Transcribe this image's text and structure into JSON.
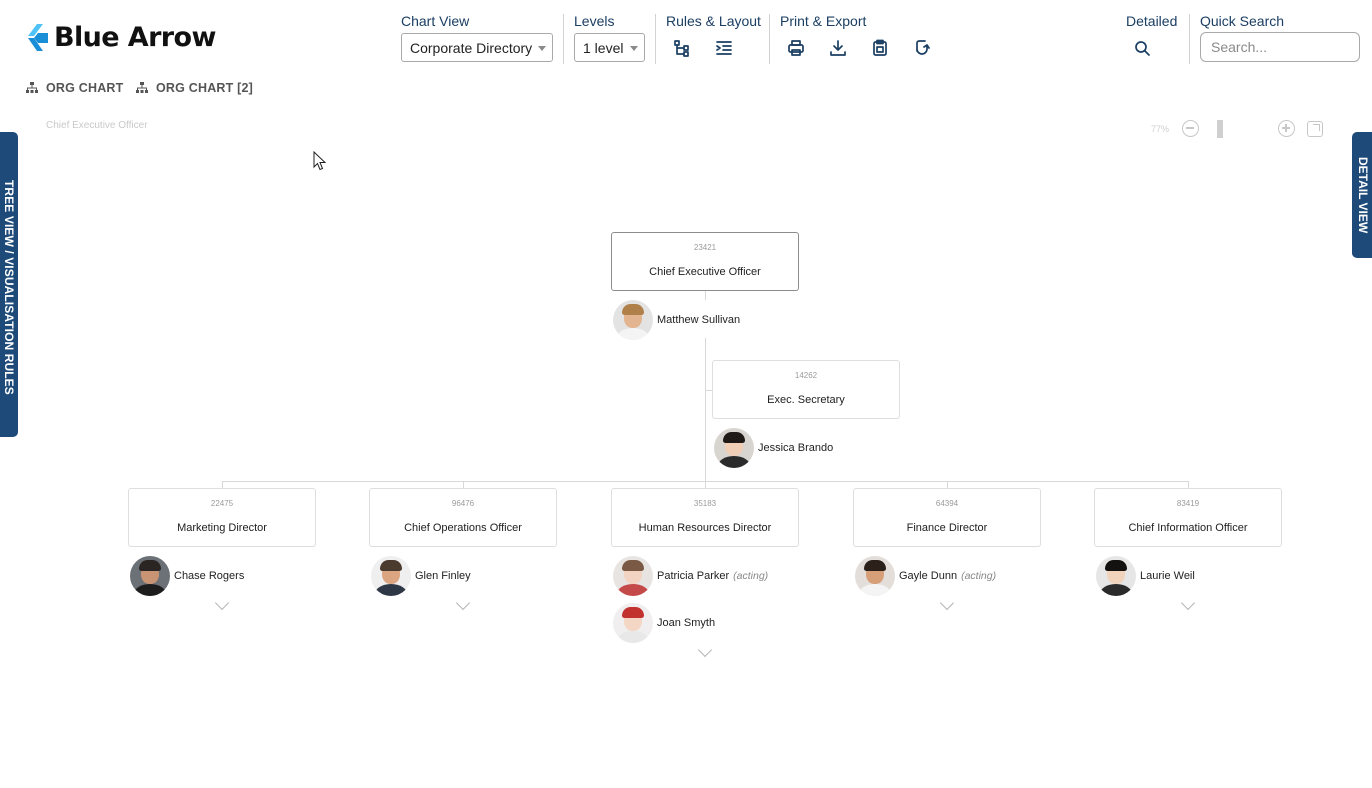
{
  "brand": {
    "name": "Blue Arrow",
    "accent": "#1a8fd8",
    "accent_light": "#4fc3f7",
    "navy": "#1d4a78"
  },
  "toolbar": {
    "chart_view_label": "Chart View",
    "chart_view_value": "Corporate Directory",
    "levels_label": "Levels",
    "levels_value": "1 level",
    "rules_layout_label": "Rules & Layout",
    "rules_layout_icons": [
      "tree-structure-icon",
      "indent-list-icon"
    ],
    "print_export_label": "Print & Export",
    "print_export_icons": [
      "print-icon",
      "download-icon",
      "clipboard-icon",
      "refresh-icon"
    ],
    "detailed_label": "Detailed",
    "detailed_icon": "search-icon",
    "quick_search_label": "Quick Search",
    "quick_search_placeholder": "Search..."
  },
  "tabs": [
    {
      "label": "ORG CHART",
      "icon": "org-chart-icon"
    },
    {
      "label": "ORG CHART [2]",
      "icon": "org-chart-icon"
    }
  ],
  "breadcrumb": "Chief Executive Officer",
  "zoom": {
    "level_text": "77%"
  },
  "side_panels": {
    "left": "TREE VIEW / VISUALISATION RULES",
    "right": "DETAIL VIEW"
  },
  "org": {
    "root": {
      "code": "23421",
      "title": "Chief Executive Officer",
      "people": [
        {
          "name": "Matthew Sullivan",
          "acting": "",
          "avatar": "man-beard"
        }
      ]
    },
    "assistant": {
      "code": "14262",
      "title": "Exec. Secretary",
      "people": [
        {
          "name": "Jessica Brando",
          "acting": "",
          "avatar": "woman-dark-hair"
        }
      ]
    },
    "children": [
      {
        "code": "22475",
        "title": "Marketing Director",
        "people": [
          {
            "name": "Chase Rogers",
            "acting": "",
            "avatar": "man-dark"
          }
        ]
      },
      {
        "code": "96476",
        "title": "Chief Operations Officer",
        "people": [
          {
            "name": "Glen Finley",
            "acting": "",
            "avatar": "man-smiling"
          }
        ]
      },
      {
        "code": "35183",
        "title": "Human Resources Director",
        "people": [
          {
            "name": "Patricia Parker",
            "acting": "(acting)",
            "avatar": "woman-light"
          },
          {
            "name": "Joan Smyth",
            "acting": "",
            "avatar": "woman-red-hair"
          }
        ]
      },
      {
        "code": "64394",
        "title": "Finance Director",
        "people": [
          {
            "name": "Gayle Dunn",
            "acting": "(acting)",
            "avatar": "woman-curly"
          }
        ]
      },
      {
        "code": "83419",
        "title": "Chief Information Officer",
        "people": [
          {
            "name": "Laurie Weil",
            "acting": "",
            "avatar": "woman-black-hair"
          }
        ]
      }
    ]
  }
}
